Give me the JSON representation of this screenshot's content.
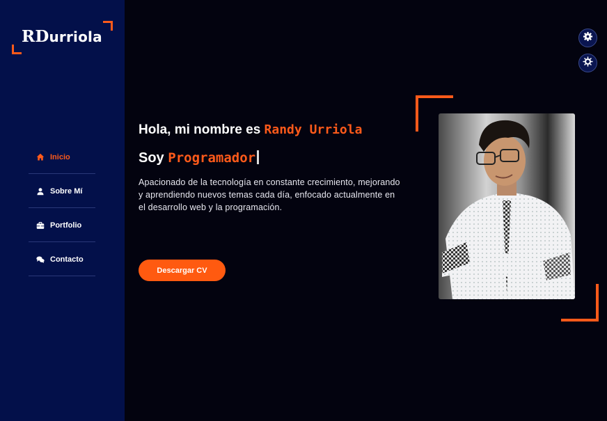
{
  "brand": {
    "logo_main": "RD",
    "logo_rest": "urriola"
  },
  "nav": {
    "items": [
      {
        "label": "Inicio",
        "icon": "home-icon",
        "active": true
      },
      {
        "label": "Sobre Mí",
        "icon": "user-icon",
        "active": false
      },
      {
        "label": "Portfolio",
        "icon": "briefcase-icon",
        "active": false
      },
      {
        "label": "Contacto",
        "icon": "chat-icon",
        "active": false
      }
    ]
  },
  "hero": {
    "greeting": "Hola, mi nombre es ",
    "name": "Randy Urriola",
    "role_prefix": "Soy ",
    "role": "Programador",
    "description": "Apacionado de la tecnología en constante crecimiento, mejorando y aprendiendo nuevos temas cada día, enfocado actualmente en el desarrollo web y la programación.",
    "cta_label": "Descargar CV"
  },
  "settings": {
    "icons": [
      "gear-icon",
      "sun-gear-icon"
    ]
  },
  "colors": {
    "accent": "#ff5a1a",
    "sidebar": "#03104a",
    "background": "#03030f"
  }
}
